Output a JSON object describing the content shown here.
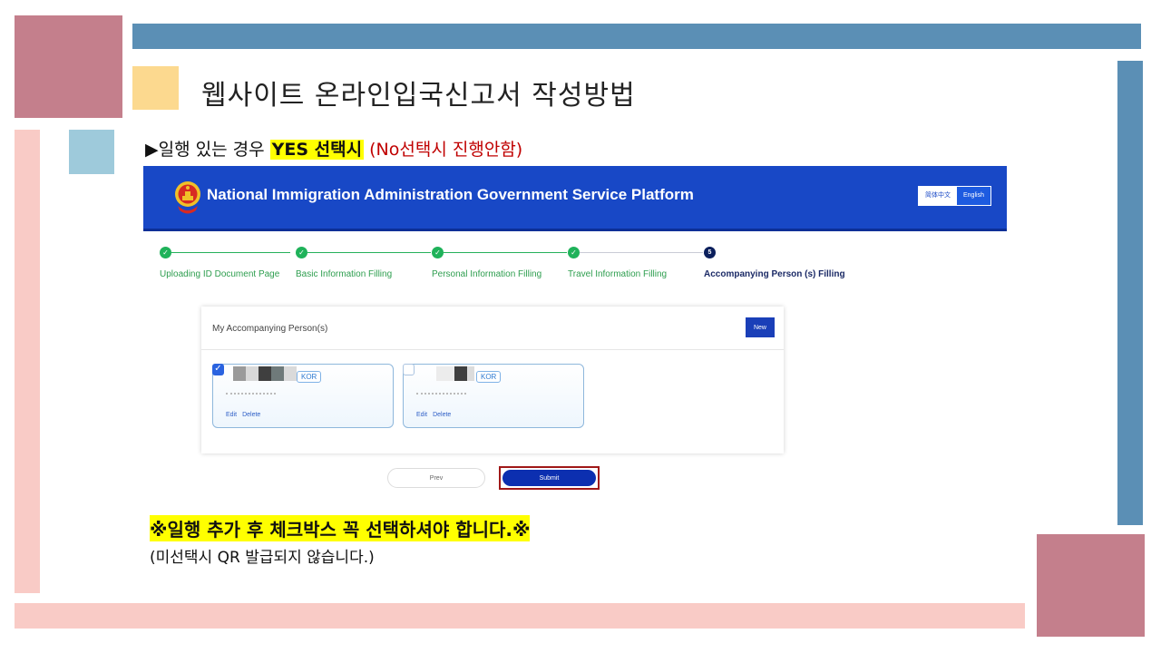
{
  "colors": {
    "deco_pink": "#c47f8c",
    "deco_blue": "#5b8fb5",
    "deco_yellow": "#fcd98f",
    "deco_light_pink": "#f9cbc6",
    "deco_light_blue": "#9ecadb",
    "portal_header": "#1848c6",
    "step_complete": "#1fb25a",
    "step_current": "#0b1f5c",
    "highlight": "#ffff00",
    "annotation_red": "#c00000"
  },
  "slide": {
    "title": "웹사이트 온라인입국신고서 작성방법",
    "instruction": {
      "marker": "▶",
      "prefix": "일행 있는 경우 ",
      "highlight": "YES 선택시",
      "note": " (No선택시 진행안함)"
    },
    "notice_main": "※일행 추가 후 체크박스 꼭 선택하셔야 합니다.※",
    "notice_sub": "(미선택시 QR 발급되지 않습니다.)"
  },
  "portal": {
    "title": "National Immigration Administration Government Service Platform",
    "emblem_icon": "national-emblem-icon",
    "languages": [
      "简体中文",
      "English"
    ],
    "steps": [
      {
        "label": "Uploading ID Document Page",
        "status": "complete",
        "mark": "✓"
      },
      {
        "label": "Basic Information Filling",
        "status": "complete",
        "mark": "✓"
      },
      {
        "label": "Personal Information Filling",
        "status": "complete",
        "mark": "✓"
      },
      {
        "label": "Travel Information Filling",
        "status": "complete",
        "mark": "✓"
      },
      {
        "label": "Accompanying Person (s) Filling",
        "status": "current",
        "mark": "5"
      }
    ],
    "panel_title": "My Accompanying Person(s)",
    "new_label": "New",
    "persons": [
      {
        "nationality": "KOR",
        "checked": true,
        "edit": "Edit",
        "delete": "Delete"
      },
      {
        "nationality": "KOR",
        "checked": false,
        "edit": "Edit",
        "delete": "Delete"
      }
    ],
    "prev_label": "Prev",
    "submit_label": "Submit"
  }
}
